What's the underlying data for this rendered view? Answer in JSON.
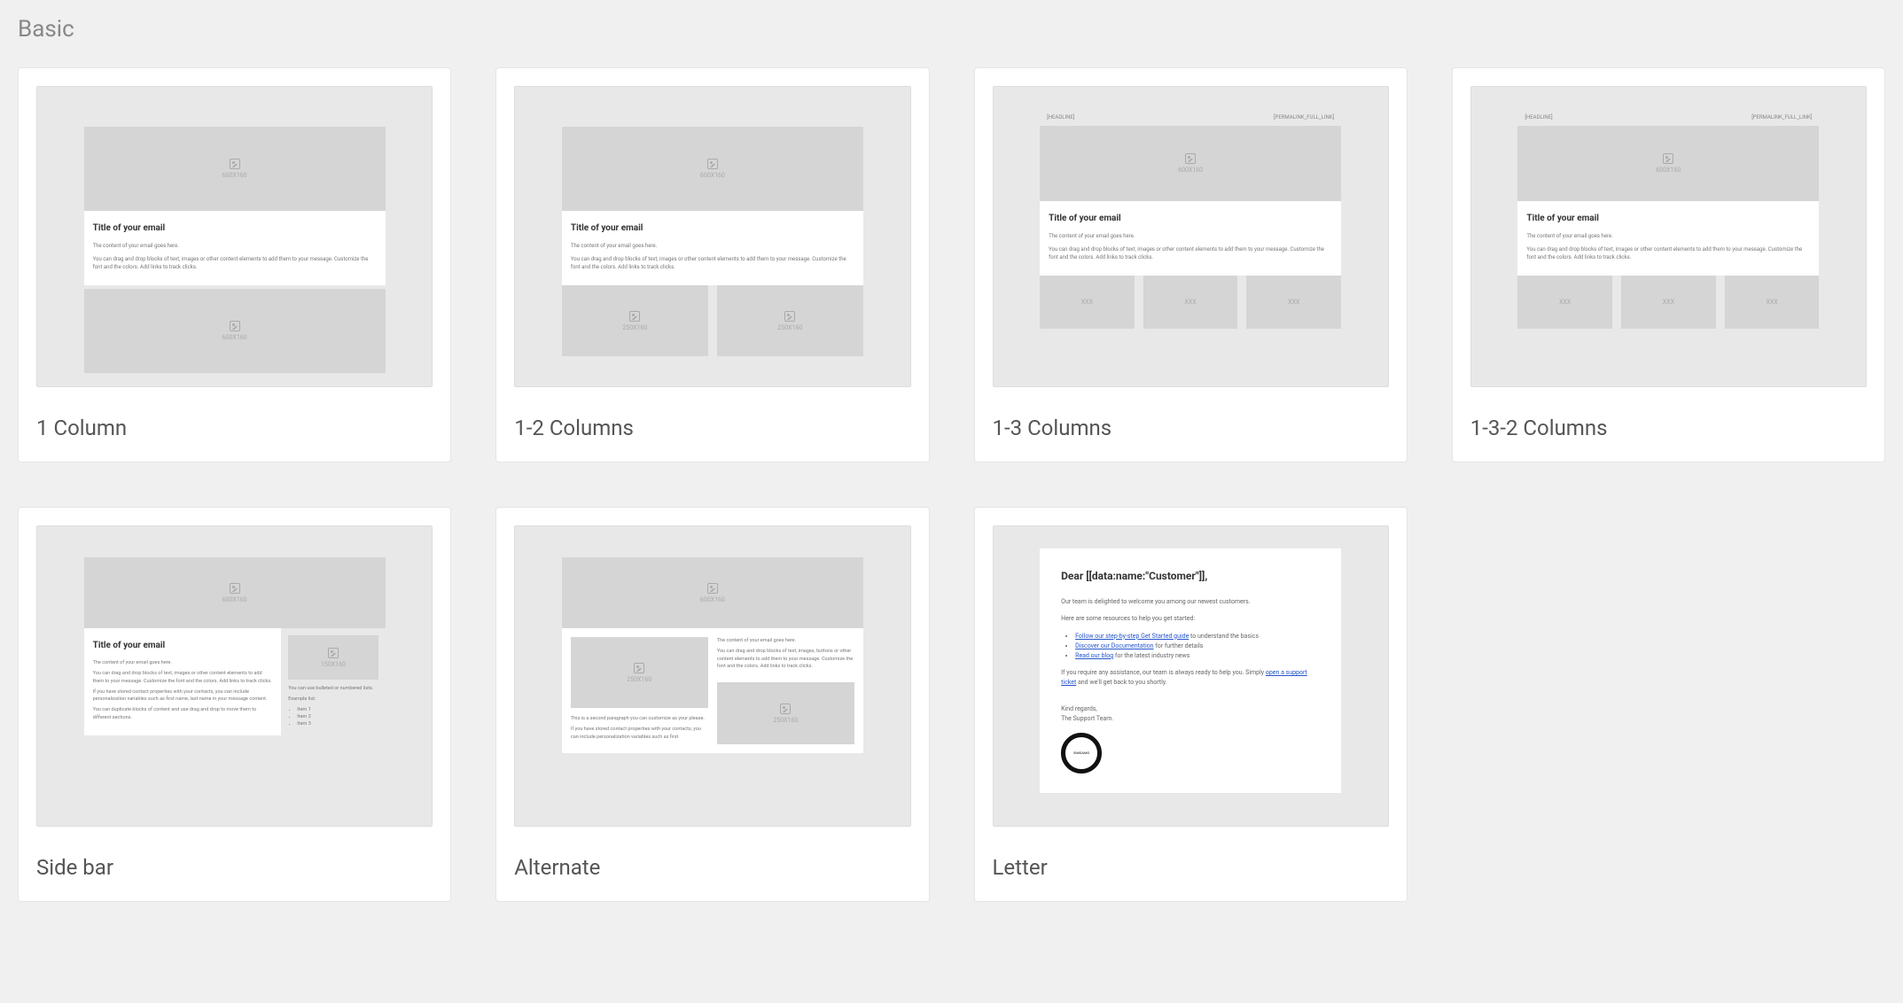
{
  "section": {
    "title": "Basic"
  },
  "cards": [
    {
      "title": "1 Column"
    },
    {
      "title": "1-2 Columns"
    },
    {
      "title": "1-3 Columns"
    },
    {
      "title": "1-3-2 Columns"
    },
    {
      "title": "Side bar"
    },
    {
      "title": "Alternate"
    },
    {
      "title": "Letter"
    }
  ],
  "thumb_common": {
    "hero_label": "600X160",
    "email_title": "Title of your email",
    "content_line": "The content of your email goes here.",
    "content_body": "You can drag and drop blocks of text, images or other content elements to add them to your message. Customize the font and the colors. Add links to track clicks.",
    "topbar_left": "[HEADLINE]",
    "topbar_right": "[PERMALINK_FULL_LINK]",
    "col2_label": "250X160",
    "col3_label": "XXX"
  },
  "sidebar_thumb": {
    "content_line": "The content of your email goes here.",
    "para1": "You can drag and drop blocks of text, images or other content elements to add them to your message. Customize the font and the colors. Add links to track clicks.",
    "para2": "If you have stored contact properties with your contacts, you can include personalization variables such as first name, last name in your message content.",
    "para3": "You can duplicate blocks of content and use drag and drop to move them to different sections.",
    "side_img_label": "150X160",
    "side_text": "You can use bulleted or numbered lists.",
    "side_list_title": "Example list:",
    "items": [
      "Item 1",
      "Item 2",
      "Item 3"
    ]
  },
  "alternate_thumb": {
    "content_line": "The content of your email goes here.",
    "para1": "You can drag and drop blocks of text, images, buttons or other content elements to add them to your message. Customize the font and the colors. Add links to track clicks.",
    "para2": "This is a second paragraph you can customize as your please.",
    "para3": "If you have stored contact properties with your contacts, you can include personalization variables such as first",
    "img_label": "250X160"
  },
  "letter_thumb": {
    "greeting": "Dear [[data:name:\"Customer\"]],",
    "line1": "Our team is delighted to welcome you among our newest customers.",
    "line2": "Here are some resources to help you get started:",
    "bullet1_link": "Follow our step-by-step Get Started guide",
    "bullet1_rest": " to understand the basics",
    "bullet2_link": "Discover our Documentation",
    "bullet2_rest": " for further details",
    "bullet3_link": "Read our blog",
    "bullet3_rest": " for the latest industry news",
    "para_support_pre": "If you require any assistance, our team is always ready to help you. Simply ",
    "para_support_link": "open a support ticket",
    "para_support_post": " and we'll get back to you shortly.",
    "regards": "Kind regards,",
    "team": "The Support Team.",
    "badge_text": "SIMSAMO"
  }
}
